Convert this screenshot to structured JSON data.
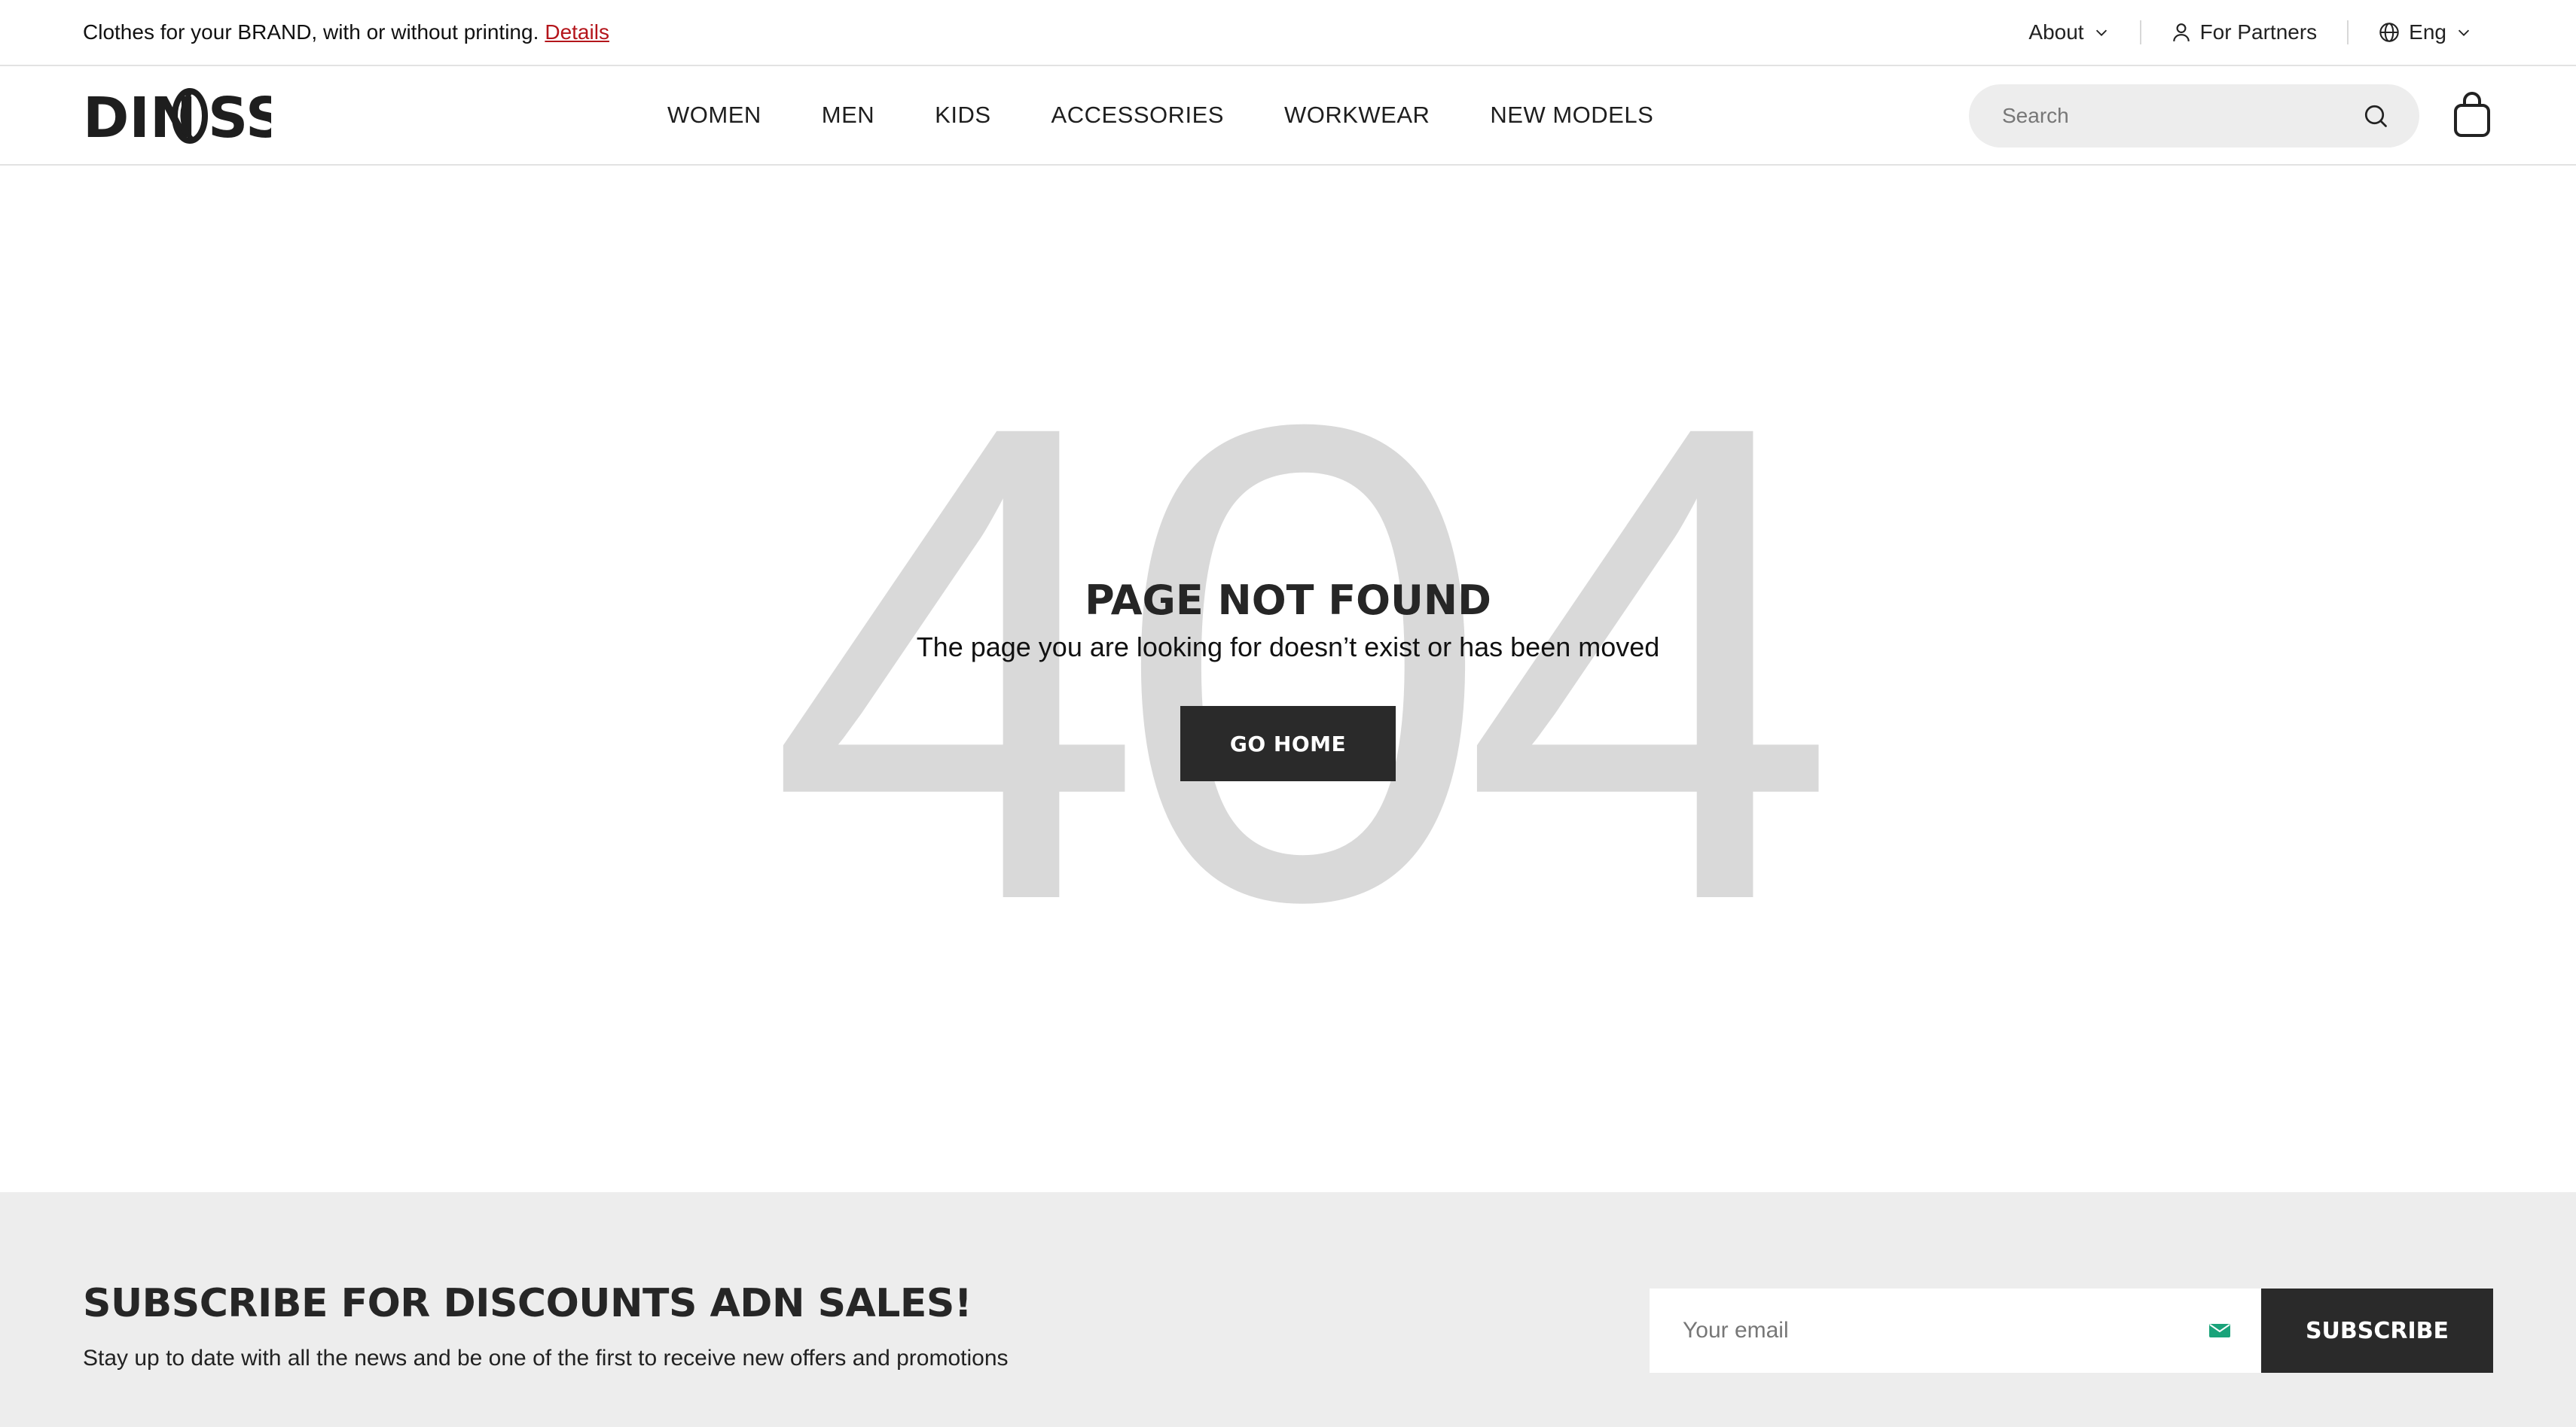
{
  "topbar": {
    "promo_text": "Clothes for your BRAND, with or without printing.",
    "promo_link": "Details",
    "about": "About",
    "partners": "For Partners",
    "language": "Eng"
  },
  "header": {
    "logo": "DINOSS",
    "nav": [
      "WOMEN",
      "MEN",
      "KIDS",
      "ACCESSORIES",
      "WORKWEAR",
      "NEW MODELS"
    ],
    "search_placeholder": "Search"
  },
  "error": {
    "code": "404",
    "title": "PAGE NOT FOUND",
    "message": "The page you are looking for doesn’t exist or has been moved",
    "button": "GO HOME"
  },
  "subscribe": {
    "title": "SUBSCRIBE FOR DISCOUNTS ADN SALES!",
    "text": "Stay up to date with all the news and be one of the first to receive new offers and promotions",
    "email_placeholder": "Your email",
    "button": "SUBSCRIBE"
  },
  "colors": {
    "accent_link": "#b4151b",
    "dark_button": "#2a2a2a",
    "mail_icon": "#1aa37a",
    "big_code": "#d9d9d9",
    "footer_bg": "#ededed"
  }
}
